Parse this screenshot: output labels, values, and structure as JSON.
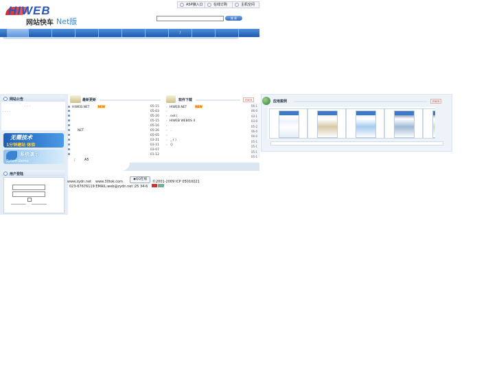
{
  "header": {
    "logo_text": "HIWEB",
    "logo_cn": "网站快车",
    "logo_suffix": "Net版",
    "top_links": [
      "ASP接入口",
      "在线订购",
      "主机空间"
    ],
    "search_placeholder": "",
    "search_button": "搜 索"
  },
  "nav": {
    "items": [
      "",
      "",
      "",
      "",
      "",
      "",
      "",
      "/",
      "",
      "",
      ""
    ]
  },
  "sidebar": {
    "notice_title": "网站公告",
    "notice_lines": [
      "·  ·  ·",
      "·  ·  ·  ·"
    ],
    "banner1_line1": "无需技术",
    "banner1_line2": "1分钟建站 体验",
    "banner2_line1": "系统演示",
    "banner2_line2": "Sytem Demo",
    "login_title": "用户登陆"
  },
  "latest": {
    "title": "最新更新",
    "new_badge": "NEW",
    "items": [
      {
        "text": "HIWEB.NET",
        "date": "05-15",
        "is_new": true
      },
      {
        "text": "",
        "date": "05-03"
      },
      {
        "text": "",
        "date": "05-20"
      },
      {
        "text": "",
        "date": "05-15"
      },
      {
        "text": "",
        "date": "05-16"
      },
      {
        "text": "NET",
        "date": "05-26"
      },
      {
        "text": "",
        "date": "05-05"
      },
      {
        "text": "",
        "date": "03-21"
      },
      {
        "text": "",
        "date": "03-11"
      },
      {
        "text": "",
        "date": "03-07"
      },
      {
        "text": "",
        "date": "01-12"
      }
    ],
    "footer_left": ";",
    "footer_right": "A5"
  },
  "downloads": {
    "title": "软件下载",
    "more": "more",
    "items": [
      {
        "text": "HIWEB.NET",
        "is_new": true
      },
      {
        "text": ""
      },
      {
        "text": ".net      ("
      },
      {
        "text": "HIWEB          WEBOS II"
      },
      {
        "text": ""
      },
      {
        "text": "          ."
      },
      {
        "text": ""
      },
      {
        "text": "        _  (    )"
      },
      {
        "text": "        ()"
      }
    ]
  },
  "cases": {
    "title": "应用案例",
    "more": "more",
    "side_dates": [
      "06-1",
      "06-0",
      "03-1",
      "03-0",
      "05-2",
      "06-0",
      "06-0",
      "05-1",
      "05-1",
      "05-1",
      "05-1"
    ]
  },
  "footer": {
    "link1": "www.zydn.net",
    "link2": "www.30tok.com",
    "qq_label": "QQ在线",
    "copyright": "©2001-2009  ICP 05010021",
    "contact": "023-67676119 EMAIL:web@zydn.net :",
    "info": "25    34-6"
  }
}
